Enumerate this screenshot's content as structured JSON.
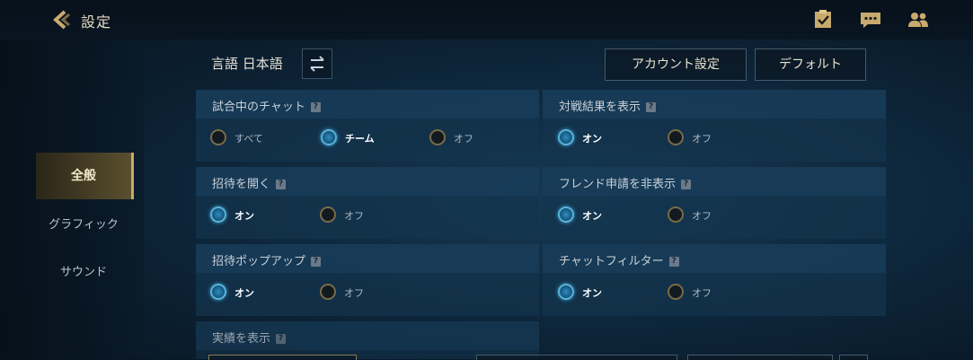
{
  "header": {
    "title": "設定"
  },
  "language": {
    "label": "言語 日本語"
  },
  "buttons": {
    "account": "アカウント設定",
    "default": "デフォルト"
  },
  "sidebar": {
    "items": [
      {
        "label": "全般"
      },
      {
        "label": "グラフィック"
      },
      {
        "label": "サウンド"
      }
    ]
  },
  "settings": {
    "ingame_chat": {
      "title": "試合中のチャット",
      "options": [
        "すべて",
        "チーム",
        "オフ"
      ]
    },
    "match_result": {
      "title": "対戦結果を表示",
      "options": [
        "オン",
        "オフ"
      ]
    },
    "open_invite": {
      "title": "招待を開く",
      "options": [
        "オン",
        "オフ"
      ]
    },
    "hide_friend_req": {
      "title": "フレンド申請を非表示",
      "options": [
        "オン",
        "オフ"
      ]
    },
    "invite_popup": {
      "title": "招待ポップアップ",
      "options": [
        "オン",
        "オフ"
      ]
    },
    "chat_filter": {
      "title": "チャットフィルター",
      "options": [
        "オン",
        "オフ"
      ]
    },
    "achievements": {
      "title": "実績を表示"
    }
  },
  "help_glyph": "?",
  "colors": {
    "accent_gold": "#c8aa6e",
    "selected_blue": "#2e8cc0"
  }
}
